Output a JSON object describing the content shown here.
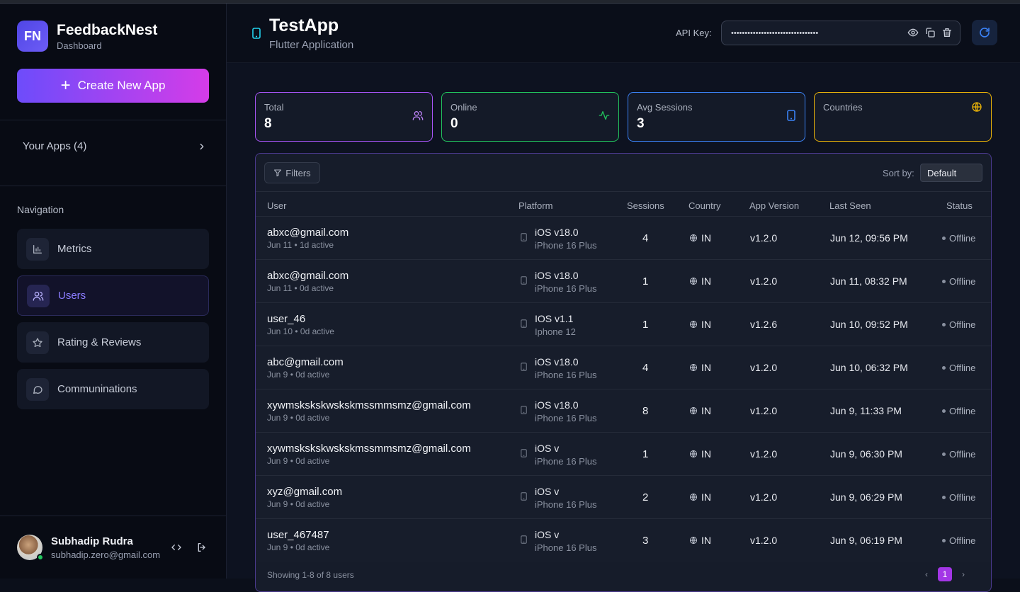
{
  "sidebar": {
    "logo_initials": "FN",
    "brand_name": "FeedbackNest",
    "brand_sub": "Dashboard",
    "create_button": "Create New App",
    "your_apps": "Your Apps (4)",
    "nav_title": "Navigation",
    "nav_items": [
      {
        "label": "Metrics",
        "icon": "chart-icon"
      },
      {
        "label": "Users",
        "icon": "users-icon",
        "active": true
      },
      {
        "label": "Rating & Reviews",
        "icon": "star-icon"
      },
      {
        "label": "Communinations",
        "icon": "chat-icon"
      }
    ],
    "user": {
      "name": "Subhadip Rudra",
      "email": "subhadip.zero@gmail.com"
    }
  },
  "header": {
    "app_name": "TestApp",
    "app_type": "Flutter Application",
    "api_label": "API Key:",
    "api_key_masked": "••••••••••••••••••••••••••••••••"
  },
  "stats": [
    {
      "label": "Total",
      "value": "8",
      "color": "#a855f7",
      "icon": "users-icon"
    },
    {
      "label": "Online",
      "value": "0",
      "color": "#22c55e",
      "icon": "activity-icon"
    },
    {
      "label": "Avg Sessions",
      "value": "3",
      "color": "#3b82f6",
      "icon": "phone-icon"
    },
    {
      "label": "Countries",
      "value": "",
      "color": "#eab308",
      "icon": "globe-icon"
    }
  ],
  "table": {
    "filters_label": "Filters",
    "sort_label": "Sort by:",
    "sort_value": "Default",
    "columns": [
      "User",
      "Platform",
      "Sessions",
      "Country",
      "App Version",
      "Last Seen",
      "Status"
    ],
    "rows": [
      {
        "user": "abxc@gmail.com",
        "meta": "Jun 11 • 1d active",
        "os": "iOS v18.0",
        "device": "iPhone 16 Plus",
        "sessions": "4",
        "country": "IN",
        "version": "v1.2.0",
        "last_seen": "Jun 12, 09:56 PM",
        "status": "Offline"
      },
      {
        "user": "abxc@gmail.com",
        "meta": "Jun 11 • 0d active",
        "os": "iOS v18.0",
        "device": "iPhone 16 Plus",
        "sessions": "1",
        "country": "IN",
        "version": "v1.2.0",
        "last_seen": "Jun 11, 08:32 PM",
        "status": "Offline"
      },
      {
        "user": "user_46",
        "meta": "Jun 10 • 0d active",
        "os": "IOS v1.1",
        "device": "Iphone 12",
        "sessions": "1",
        "country": "IN",
        "version": "v1.2.6",
        "last_seen": "Jun 10, 09:52 PM",
        "status": "Offline"
      },
      {
        "user": "abc@gmail.com",
        "meta": "Jun 9 • 0d active",
        "os": "iOS v18.0",
        "device": "iPhone 16 Plus",
        "sessions": "4",
        "country": "IN",
        "version": "v1.2.0",
        "last_seen": "Jun 10, 06:32 PM",
        "status": "Offline"
      },
      {
        "user": "xywmskskskwskskmssmmsmz@gmail.com",
        "meta": "Jun 9 • 0d active",
        "os": "iOS v18.0",
        "device": "iPhone 16 Plus",
        "sessions": "8",
        "country": "IN",
        "version": "v1.2.0",
        "last_seen": "Jun 9, 11:33 PM",
        "status": "Offline"
      },
      {
        "user": "xywmskskskwskskmssmmsmz@gmail.com",
        "meta": "Jun 9 • 0d active",
        "os": "iOS v",
        "device": "iPhone 16 Plus",
        "sessions": "1",
        "country": "IN",
        "version": "v1.2.0",
        "last_seen": "Jun 9, 06:30 PM",
        "status": "Offline"
      },
      {
        "user": "xyz@gmail.com",
        "meta": "Jun 9 • 0d active",
        "os": "iOS v",
        "device": "iPhone 16 Plus",
        "sessions": "2",
        "country": "IN",
        "version": "v1.2.0",
        "last_seen": "Jun 9, 06:29 PM",
        "status": "Offline"
      },
      {
        "user": "user_467487",
        "meta": "Jun 9 • 0d active",
        "os": "iOS v",
        "device": "iPhone 16 Plus",
        "sessions": "3",
        "country": "IN",
        "version": "v1.2.0",
        "last_seen": "Jun 9, 06:19 PM",
        "status": "Offline"
      }
    ],
    "footer": "Showing 1-8 of 8 users",
    "current_page": "1"
  }
}
